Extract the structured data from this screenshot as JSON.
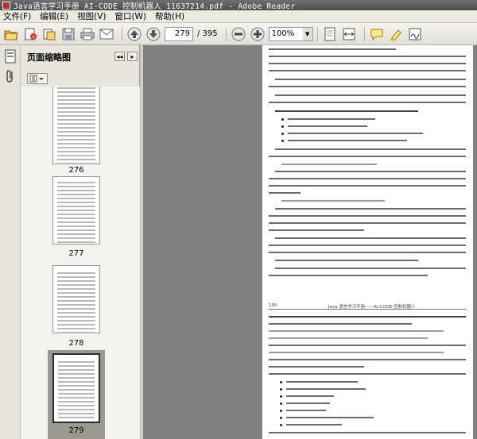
{
  "window": {
    "title": "Java语言学习手册  AI-CODE 控制机器人_11637214.pdf - Adobe Reader"
  },
  "menu": {
    "items": [
      "文件(F)",
      "编辑(E)",
      "视图(V)",
      "窗口(W)",
      "帮助(H)"
    ]
  },
  "toolbar": {
    "current_page": "279",
    "total_pages": "/ 395",
    "zoom": "100%",
    "zoom_arrow": "▼",
    "icons": [
      "open-icon",
      "create-pdf-icon",
      "organize-icon",
      "save-icon",
      "print-icon",
      "email-icon",
      "prev-page-icon",
      "next-page-icon",
      "zoom-out-icon",
      "zoom-in-icon",
      "fit-page-icon",
      "fit-width-icon",
      "comment-icon",
      "highlight-icon",
      "sign-icon"
    ]
  },
  "panel": {
    "title": "页面缩略图",
    "collapse": "◂◂",
    "close": "▸",
    "thumbnails": [
      {
        "label": "276",
        "selected": false
      },
      {
        "label": "277",
        "selected": false
      },
      {
        "label": "278",
        "selected": false
      },
      {
        "label": "279",
        "selected": true
      }
    ]
  },
  "document": {
    "page2_header_left": "100",
    "page2_header_center": "Java 语言学习手册——AI-CODE 控制机器人",
    "page2_header_right": ""
  },
  "colors": {
    "titlebar": "#5a5a5a",
    "viewer_bg": "#808080",
    "page_bg": "#ffffff",
    "selected_thumb": "#2b2b2b"
  }
}
